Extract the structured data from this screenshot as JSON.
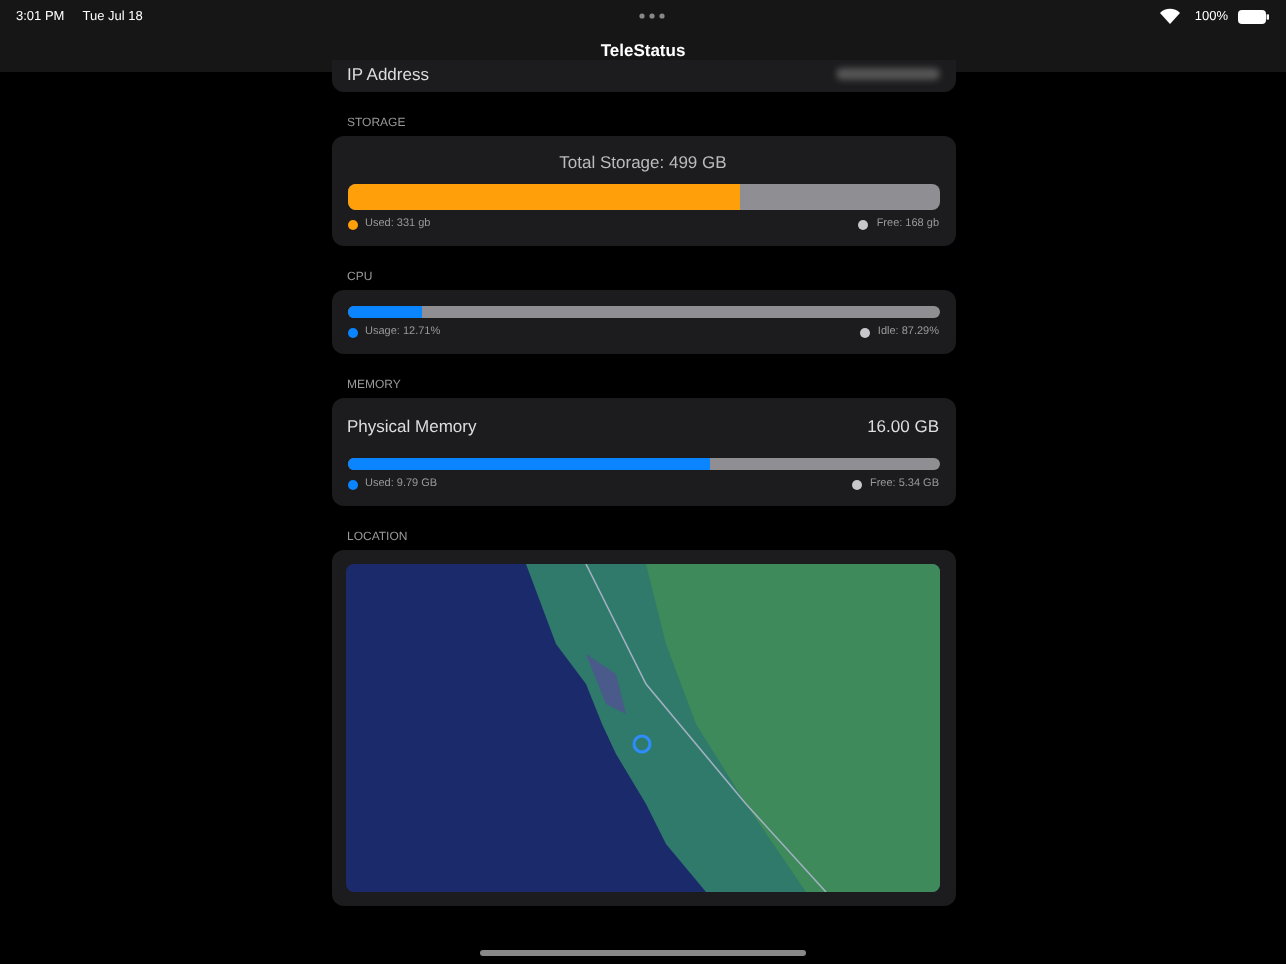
{
  "status_bar": {
    "time": "3:01 PM",
    "date": "Tue Jul 18",
    "battery": "100%"
  },
  "nav": {
    "title": "TeleStatus"
  },
  "ip": {
    "label": "IP Address"
  },
  "storage": {
    "header": "STORAGE",
    "title": "Total Storage: 499 GB",
    "level": 0.663,
    "used": "Used: 331 gb",
    "free": "Free: 168 gb"
  },
  "cpu": {
    "header": "CPU",
    "level": 0.127,
    "used": "Usage: 12.71%",
    "free": "Idle: 87.29%"
  },
  "memory": {
    "header": "MEMORY",
    "label": "Physical Memory",
    "total": "16.00 GB",
    "level": 0.612,
    "used": "Used: 9.79 GB",
    "free": "Free: 5.34 GB"
  },
  "location": {
    "header": "LOCATION"
  }
}
